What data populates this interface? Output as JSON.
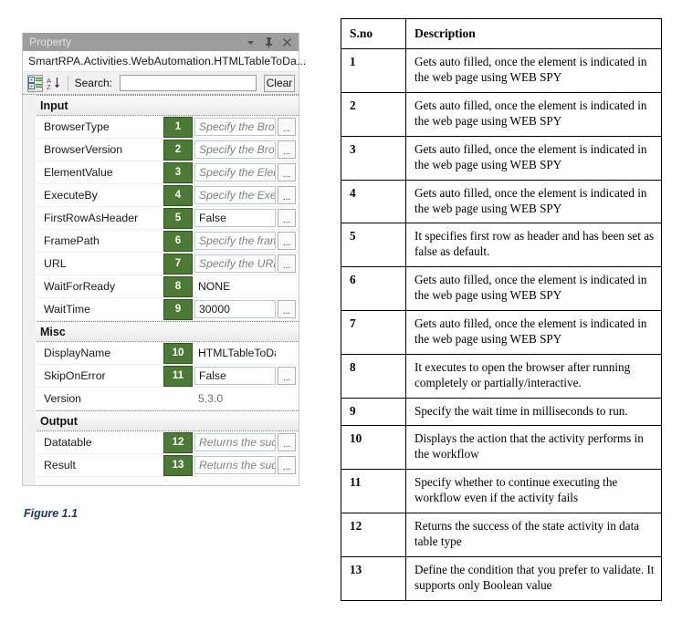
{
  "panel": {
    "title": "Property",
    "subtitle": "SmartRPA.Activities.WebAutomation.HTMLTableToDa...",
    "titlebar_icons": [
      {
        "name": "chevron-down-icon",
        "glyph": "▼"
      },
      {
        "name": "pin-icon",
        "glyph": "⚲"
      },
      {
        "name": "close-icon",
        "glyph": "✕"
      }
    ],
    "toolbar": {
      "categorized_icon": "categorized-view-icon",
      "sort_icon": "sort-alphabetical-icon",
      "search_label": "Search:",
      "search_value": "",
      "search_placeholder": "",
      "clear_label": "Clear"
    },
    "ellipsis_label": "...",
    "categories": [
      {
        "name": "Input",
        "rows": [
          {
            "name": "BrowserType",
            "badge": "1",
            "value": "Specify the Brow",
            "placeholder": true,
            "boxed": true,
            "ellipsis": true
          },
          {
            "name": "BrowserVersion",
            "badge": "2",
            "value": "Specify the Brow",
            "placeholder": true,
            "boxed": true,
            "ellipsis": true
          },
          {
            "name": "ElementValue",
            "badge": "3",
            "value": "Specify the Elem",
            "placeholder": true,
            "boxed": true,
            "ellipsis": true
          },
          {
            "name": "ExecuteBy",
            "badge": "4",
            "value": "Specify the Exec",
            "placeholder": true,
            "boxed": true,
            "ellipsis": true
          },
          {
            "name": "FirstRowAsHeader",
            "badge": "5",
            "value": "False",
            "placeholder": false,
            "boxed": true,
            "ellipsis": true
          },
          {
            "name": "FramePath",
            "badge": "6",
            "value": "Specify the fram",
            "placeholder": true,
            "boxed": true,
            "ellipsis": true
          },
          {
            "name": "URL",
            "badge": "7",
            "value": "Specify the URL",
            "placeholder": true,
            "boxed": true,
            "ellipsis": true
          },
          {
            "name": "WaitForReady",
            "badge": "8",
            "value": "NONE",
            "placeholder": false,
            "boxed": false,
            "ellipsis": false
          },
          {
            "name": "WaitTime",
            "badge": "9",
            "value": "30000",
            "placeholder": false,
            "boxed": true,
            "ellipsis": true
          }
        ]
      },
      {
        "name": "Misc",
        "rows": [
          {
            "name": "DisplayName",
            "badge": "10",
            "value": "HTMLTableToDataTab",
            "placeholder": false,
            "boxed": false,
            "ellipsis": false
          },
          {
            "name": "SkipOnError",
            "badge": "11",
            "value": "False",
            "placeholder": false,
            "boxed": true,
            "ellipsis": true
          },
          {
            "name": "Version",
            "badge": "",
            "value": "5.3.0",
            "placeholder": false,
            "boxed": false,
            "ellipsis": false,
            "muted": true
          }
        ]
      },
      {
        "name": "Output",
        "rows": [
          {
            "name": "Datatable",
            "badge": "12",
            "value": "Returns the succ",
            "placeholder": true,
            "boxed": true,
            "ellipsis": true
          },
          {
            "name": "Result",
            "badge": "13",
            "value": "Returns the succ",
            "placeholder": true,
            "boxed": true,
            "ellipsis": true
          }
        ]
      }
    ]
  },
  "figure_caption": "Figure 1.1",
  "table": {
    "headers": [
      "S.no",
      "Description"
    ],
    "rows": [
      {
        "sno": "1",
        "description": "Gets auto filled, once the element is indicated in the web page using WEB SPY"
      },
      {
        "sno": "2",
        "description": "Gets auto filled, once the element is indicated in the web page using WEB SPY"
      },
      {
        "sno": "3",
        "description": "Gets auto filled, once the element is indicated in the web page using WEB SPY"
      },
      {
        "sno": "4",
        "description": "Gets auto filled, once the element is indicated in the web page using WEB SPY"
      },
      {
        "sno": "5",
        "description": "It specifies first row as header and has been set as false as default."
      },
      {
        "sno": "6",
        "description": "Gets auto filled, once the element is indicated in the web page using WEB SPY"
      },
      {
        "sno": "7",
        "description": "Gets auto filled, once the element is indicated in the web page using WEB SPY"
      },
      {
        "sno": "8",
        "description": "It executes to open the browser after running completely or partially/interactive."
      },
      {
        "sno": "9",
        "description": "Specify the wait time in milliseconds to run."
      },
      {
        "sno": "10",
        "description": "Displays the action that the activity performs in the workflow"
      },
      {
        "sno": "11",
        "description": "Specify whether to continue executing the workflow even if the activity fails"
      },
      {
        "sno": "12",
        "description": "Returns the success of the state activity in data table type"
      },
      {
        "sno": "13",
        "description": "Define the condition that you prefer to validate. It supports only Boolean value"
      }
    ]
  },
  "colors": {
    "badge_green": "#4a7a33",
    "titlebar_gray": "#9d9d9d",
    "caption_blue": "#1f3864"
  }
}
